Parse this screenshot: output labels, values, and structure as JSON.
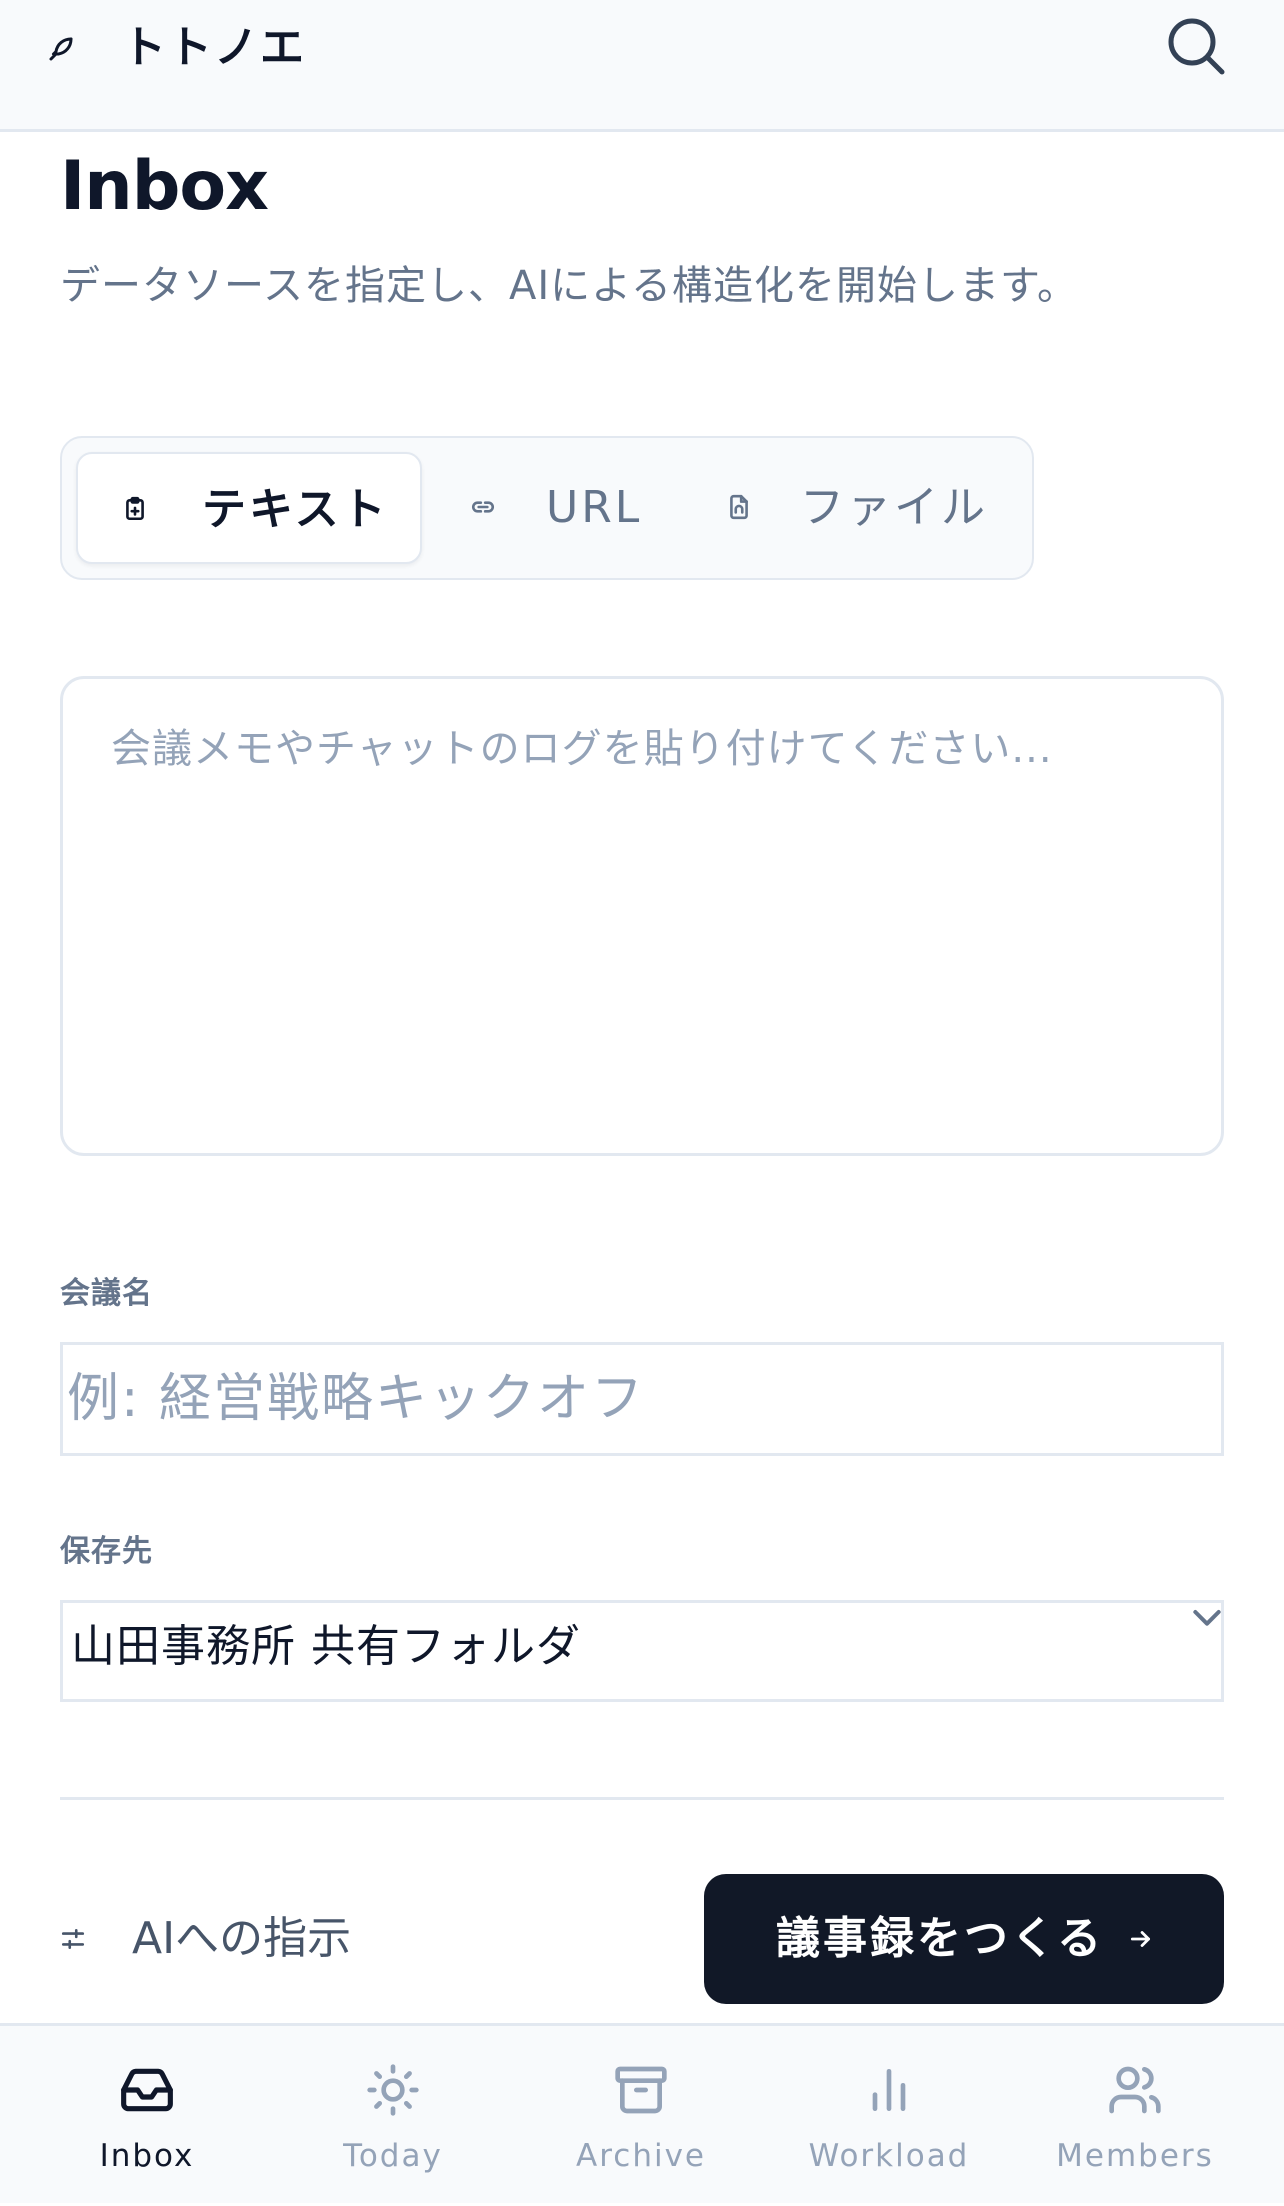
{
  "header": {
    "app_name": "トトノエ",
    "logo_icon": "feather-icon",
    "search_icon": "search-icon"
  },
  "page": {
    "title": "Inbox",
    "subtitle": "データソースを指定し、AIによる構造化を開始します。"
  },
  "source_tabs": [
    {
      "label": "テキスト",
      "icon": "clipboard-icon",
      "active": true
    },
    {
      "label": "URL",
      "icon": "link-icon",
      "active": false
    },
    {
      "label": "ファイル",
      "icon": "file-icon",
      "active": false
    }
  ],
  "memo": {
    "value": "",
    "placeholder": "会議メモやチャットのログを貼り付けてください..."
  },
  "meeting_name": {
    "label": "会議名",
    "value": "",
    "placeholder": "例: 経営戦略キックオフ"
  },
  "destination": {
    "label": "保存先",
    "selected": "山田事務所 共有フォルダ"
  },
  "actions": {
    "ai_instruction_label": "AIへの指示",
    "create_label": "議事録をつくる"
  },
  "bottom_nav": [
    {
      "label": "Inbox",
      "icon": "inbox-icon",
      "active": true
    },
    {
      "label": "Today",
      "icon": "sun-icon",
      "active": false
    },
    {
      "label": "Archive",
      "icon": "archive-icon",
      "active": false
    },
    {
      "label": "Workload",
      "icon": "bar-chart-icon",
      "active": false
    },
    {
      "label": "Members",
      "icon": "users-icon",
      "active": false
    }
  ],
  "colors": {
    "primary_dark": "#111827",
    "text_muted": "#64748b",
    "placeholder": "#94a3b8",
    "border": "#e2e8f0",
    "surface": "#f8fafc"
  }
}
